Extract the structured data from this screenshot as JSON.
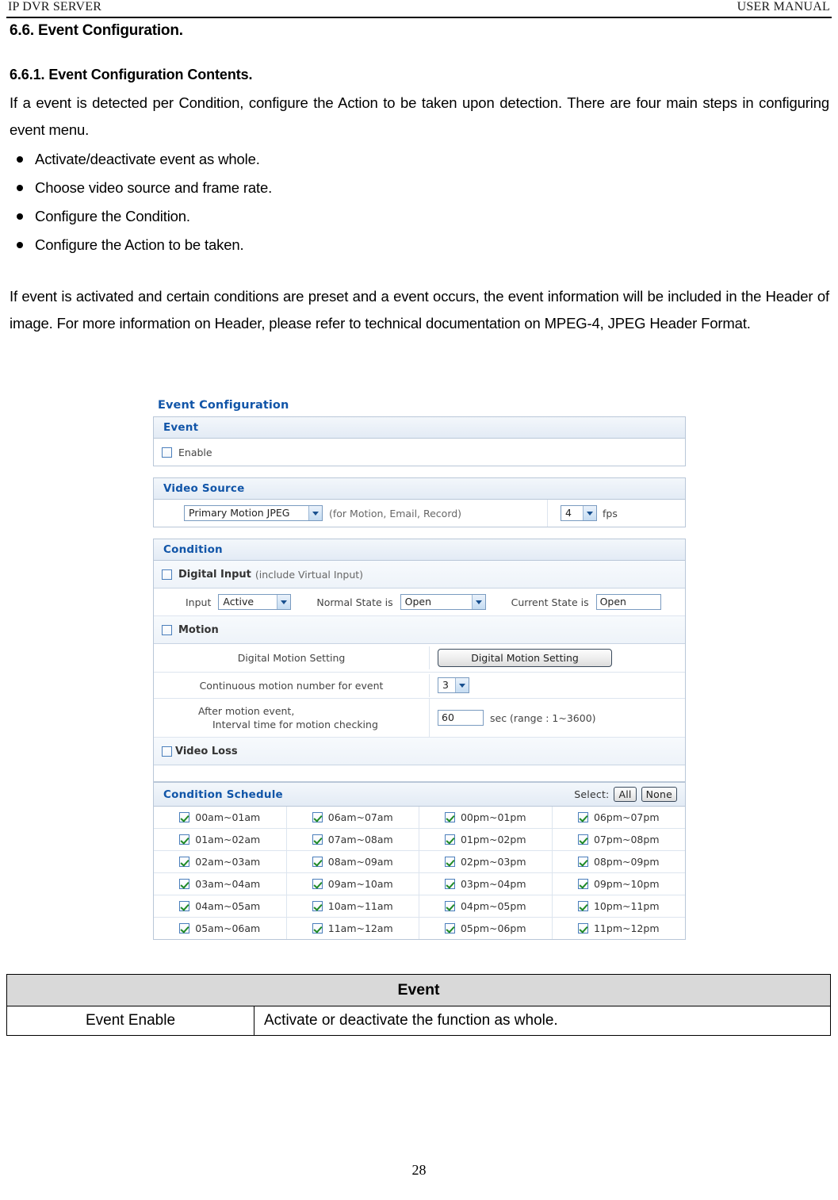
{
  "running_head": {
    "left": "IP DVR SERVER",
    "right": "USER MANUAL"
  },
  "document": {
    "section_title": "6.6. Event Configuration.",
    "subsection_title": "6.6.1.  Event Configuration Contents.",
    "intro_paragraph": "If a event is detected per Condition, configure the Action to be taken upon detection. There are four main steps in configuring event menu.",
    "bullets": [
      "Activate/deactivate event as whole.",
      "Choose video source and frame rate.",
      "Configure the Condition.",
      "Configure the Action to be taken."
    ],
    "closing_paragraph": "If event is activated and certain conditions are preset and a event occurs, the event information will be included in the Header of image. For more information on Header, please refer to technical documentation on MPEG-4, JPEG Header Format."
  },
  "screenshot": {
    "title": "Event Configuration",
    "event_panel": {
      "heading": "Event",
      "enable_label": "Enable",
      "enable_checked": false
    },
    "video_source_panel": {
      "heading": "Video Source",
      "source_value": "Primary Motion JPEG",
      "source_note": "(for Motion, Email, Record)",
      "fps_value": "4",
      "fps_label": "fps"
    },
    "condition_panel": {
      "heading": "Condition",
      "digital_input": {
        "label_strong": "Digital Input",
        "label_note": "(include Virtual Input)",
        "checked": false,
        "input_label": "Input",
        "input_value": "Active",
        "normal_state_label": "Normal State is",
        "normal_state_value": "Open",
        "current_state_label": "Current State is",
        "current_state_value": "Open"
      },
      "motion": {
        "label": "Motion",
        "checked": false,
        "rows": [
          {
            "key": "Digital Motion Setting",
            "control": "button",
            "value": "Digital Motion Setting"
          },
          {
            "key": "Continuous motion number for event",
            "control": "select",
            "value": "3"
          },
          {
            "key_line1": "After motion event,",
            "key_line2": "Interval time for motion checking",
            "control": "input",
            "value": "60",
            "suffix": "sec (range : 1~3600)"
          }
        ]
      },
      "video_loss": {
        "label": "Video Loss",
        "checked": false
      }
    },
    "condition_schedule": {
      "heading": "Condition Schedule",
      "select_label": "Select:",
      "select_all_label": "All",
      "select_none_label": "None",
      "slots": [
        {
          "label": "00am~01am",
          "checked": true
        },
        {
          "label": "06am~07am",
          "checked": true
        },
        {
          "label": "00pm~01pm",
          "checked": true
        },
        {
          "label": "06pm~07pm",
          "checked": true
        },
        {
          "label": "01am~02am",
          "checked": true
        },
        {
          "label": "07am~08am",
          "checked": true
        },
        {
          "label": "01pm~02pm",
          "checked": true
        },
        {
          "label": "07pm~08pm",
          "checked": true
        },
        {
          "label": "02am~03am",
          "checked": true
        },
        {
          "label": "08am~09am",
          "checked": true
        },
        {
          "label": "02pm~03pm",
          "checked": true
        },
        {
          "label": "08pm~09pm",
          "checked": true
        },
        {
          "label": "03am~04am",
          "checked": true
        },
        {
          "label": "09am~10am",
          "checked": true
        },
        {
          "label": "03pm~04pm",
          "checked": true
        },
        {
          "label": "09pm~10pm",
          "checked": true
        },
        {
          "label": "04am~05am",
          "checked": true
        },
        {
          "label": "10am~11am",
          "checked": true
        },
        {
          "label": "04pm~05pm",
          "checked": true
        },
        {
          "label": "10pm~11pm",
          "checked": true
        },
        {
          "label": "05am~06am",
          "checked": true
        },
        {
          "label": "11am~12am",
          "checked": true
        },
        {
          "label": "05pm~06pm",
          "checked": true
        },
        {
          "label": "11pm~12pm",
          "checked": true
        }
      ]
    }
  },
  "description_table": {
    "header": "Event",
    "rows": [
      {
        "key": "Event Enable",
        "value": "Activate or deactivate the function as whole."
      }
    ]
  },
  "page_number": "28",
  "colors": {
    "heading_blue": "#1155a8",
    "panel_border": "#b9c7d8",
    "check_green": "#1f8a26",
    "table_header_gray": "#d9d9d9"
  }
}
